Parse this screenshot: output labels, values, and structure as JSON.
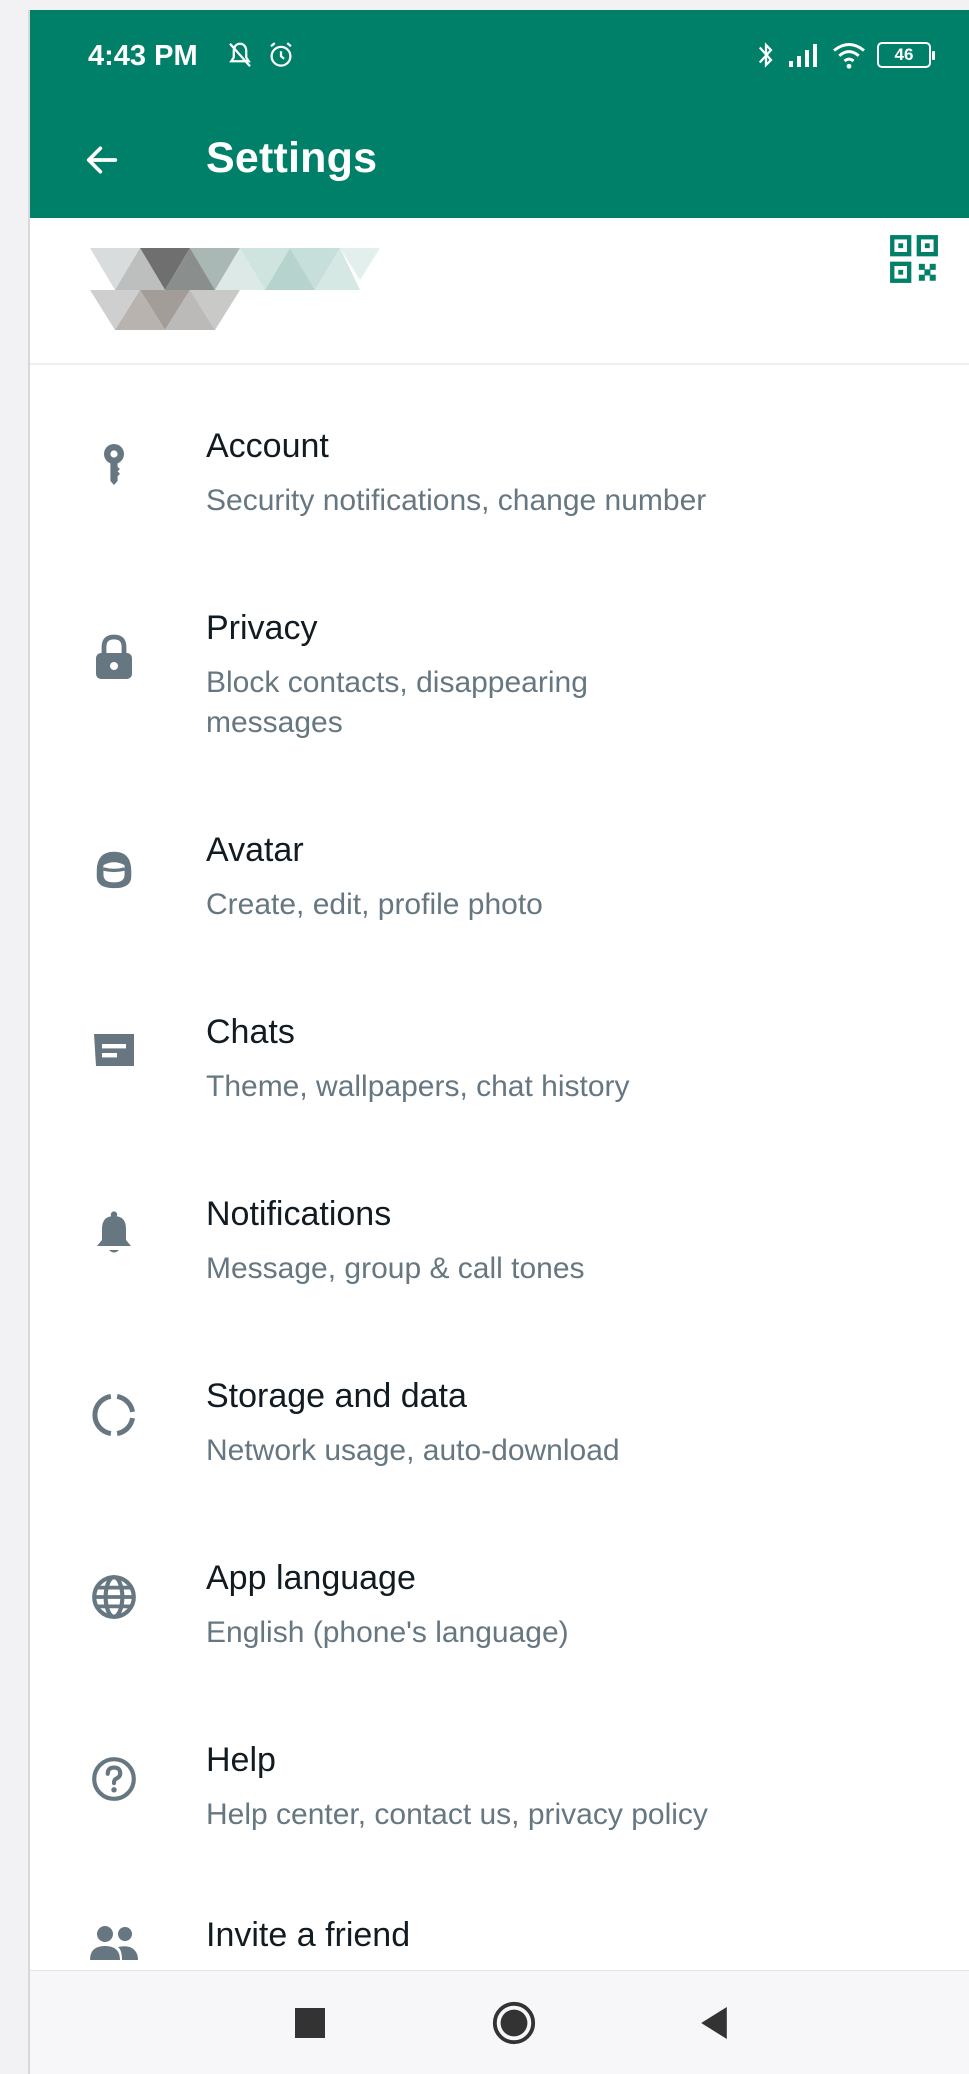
{
  "status_bar": {
    "time": "4:43 PM",
    "battery_level": "46",
    "icons": [
      "mute-icon",
      "alarm-icon",
      "bluetooth-icon",
      "signal-icon",
      "wifi-icon",
      "battery-icon"
    ]
  },
  "header": {
    "title": "Settings",
    "back_icon": "arrow-left-icon"
  },
  "profile": {
    "qr_icon": "qr-code-icon"
  },
  "settings": {
    "items": [
      {
        "title": "Account",
        "subtitle": "Security notifications, change number",
        "icon": "key-icon"
      },
      {
        "title": "Privacy",
        "subtitle": "Block contacts, disappearing messages",
        "icon": "lock-icon"
      },
      {
        "title": "Avatar",
        "subtitle": "Create, edit, profile photo",
        "icon": "avatar-face-icon"
      },
      {
        "title": "Chats",
        "subtitle": "Theme, wallpapers, chat history",
        "icon": "chat-icon"
      },
      {
        "title": "Notifications",
        "subtitle": "Message, group & call tones",
        "icon": "bell-icon"
      },
      {
        "title": "Storage and data",
        "subtitle": "Network usage, auto-download",
        "icon": "storage-circle-icon"
      },
      {
        "title": "App language",
        "subtitle": "English (phone's language)",
        "icon": "globe-icon"
      },
      {
        "title": "Help",
        "subtitle": "Help center, contact us, privacy policy",
        "icon": "help-icon"
      },
      {
        "title": "Invite a friend",
        "icon": "people-icon"
      }
    ]
  },
  "colors": {
    "brand": "#008069",
    "title_text": "#111b21",
    "secondary_text": "#667781",
    "icon_gray": "#667781"
  },
  "nav_bar": {
    "icons": [
      "square-recents-icon",
      "circle-home-icon",
      "triangle-back-icon"
    ]
  }
}
